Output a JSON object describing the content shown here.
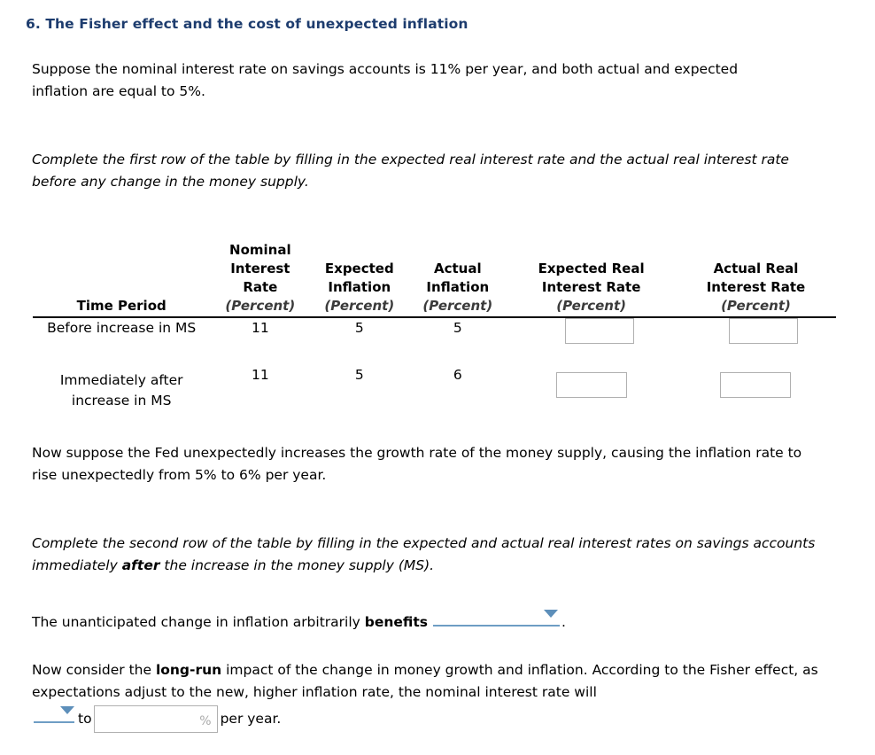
{
  "question": {
    "title": "6. The Fisher effect and the cost of unexpected inflation",
    "title_color": "#1d3c6e"
  },
  "paragraphs": {
    "intro": "Suppose the nominal interest rate on savings accounts is 11% per year, and both actual and expected inflation are equal to 5%.",
    "instruction_1": "Complete the first row of the table by filling in the expected real interest rate and the actual real interest rate before any change in the money supply.",
    "after_increase": "Now suppose the Fed unexpectedly increases the growth rate of the money supply, causing the inflation rate to rise unexpectedly from 5% to 6% per year.",
    "instruction_2_part1": "Complete the second row of the table by filling in the expected and actual real interest rates on savings accounts immediately ",
    "instruction_2_bold": "after",
    "instruction_2_part2": " the increase in the money supply (MS).",
    "benefits_part1": "The unanticipated change in inflation arbitrarily ",
    "benefits_bold": "benefits",
    "benefits_period": ".",
    "longrun_part1": "Now consider the ",
    "longrun_bold": "long-run",
    "longrun_part2": " impact of the change in money growth and inflation. According to the Fisher effect, as expectations adjust to the new, higher inflation rate, the nominal interest rate will",
    "last_to": "to",
    "last_tail": "per year."
  },
  "table": {
    "headers": [
      {
        "label": "Time Period",
        "unit": ""
      },
      {
        "label": "Nominal\nInterest\nRate",
        "unit": "(Percent)"
      },
      {
        "label": "Expected\nInflation",
        "unit": "(Percent)"
      },
      {
        "label": "Actual\nInflation",
        "unit": "(Percent)"
      },
      {
        "label": "Expected Real\nInterest Rate",
        "unit": "(Percent)"
      },
      {
        "label": "Actual Real\nInterest Rate",
        "unit": "(Percent)"
      }
    ],
    "header_labels": {
      "time_period": "Time Period",
      "nominal_l1": "Nominal",
      "nominal_l2": "Interest",
      "nominal_l3": "Rate",
      "expected_inflation_l1": "Expected",
      "expected_inflation_l2": "Inflation",
      "actual_inflation_l1": "Actual",
      "actual_inflation_l2": "Inflation",
      "expected_real_l1": "Expected Real",
      "expected_real_l2": "Interest Rate",
      "actual_real_l1": "Actual Real",
      "actual_real_l2": "Interest Rate",
      "unit": "(Percent)"
    },
    "rows": [
      {
        "time_period": "Before increase in MS",
        "nominal_interest_rate": "11",
        "expected_inflation": "5",
        "actual_inflation": "5",
        "expected_real_rate": "",
        "actual_real_rate": ""
      },
      {
        "time_period": "Immediately after increase in MS",
        "nominal_interest_rate": "11",
        "expected_inflation": "5",
        "actual_inflation": "6",
        "expected_real_rate": "",
        "actual_real_rate": ""
      }
    ]
  },
  "controls": {
    "benefits_dropdown_value": "",
    "longrun_dropdown_value": "",
    "percent_input_value": "",
    "percent_suffix": "%",
    "dropdown_color": "#6e9dc4",
    "caret_color": "#5d8fba",
    "input_border_color": "#b0b0b0"
  }
}
